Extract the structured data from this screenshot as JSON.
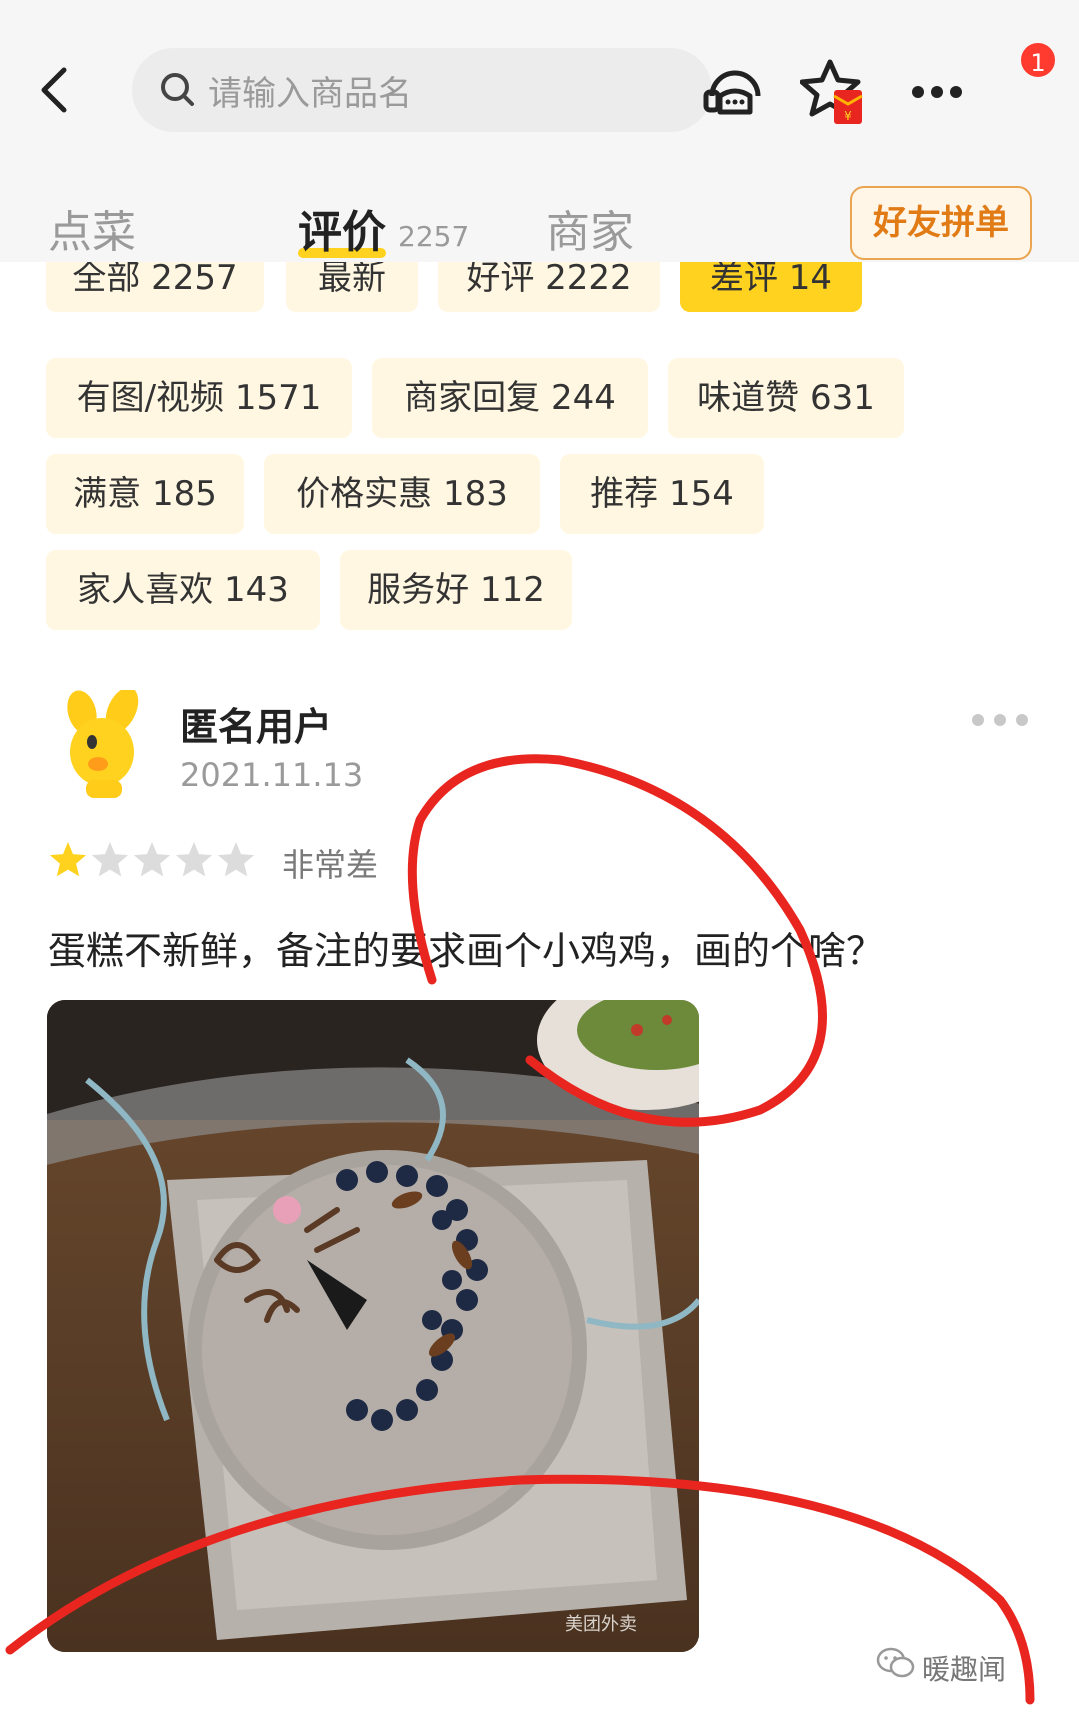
{
  "header": {
    "search_placeholder": "请输入商品名",
    "notification_count": "1"
  },
  "tabs": [
    {
      "label": "点菜"
    },
    {
      "label": "评价",
      "count": "2257"
    },
    {
      "label": "商家"
    }
  ],
  "friend_order_label": "好友拼单",
  "filters": [
    {
      "label": "全部 2257"
    },
    {
      "label": "最新"
    },
    {
      "label": "好评 2222"
    },
    {
      "label": "差评 14",
      "selected": true
    },
    {
      "label": "有图/视频 1571"
    },
    {
      "label": "商家回复 244"
    },
    {
      "label": "味道赞 631"
    },
    {
      "label": "满意 185"
    },
    {
      "label": "价格实惠 183"
    },
    {
      "label": "推荐 154"
    },
    {
      "label": "家人喜欢 143"
    },
    {
      "label": "服务好 112"
    }
  ],
  "review": {
    "user": "匿名用户",
    "date": "2021.11.13",
    "stars": 1,
    "max_stars": 5,
    "rating_text": "非常差",
    "text": "蛋糕不新鲜，备注的要求画个小鸡鸡，画的个啥？",
    "photo_watermark": "美团外卖"
  },
  "watermark": "暖趣闻",
  "colors": {
    "accent_yellow": "#ffd21f",
    "chip_bg": "#fff7e2",
    "friend_btn_text": "#e07b16",
    "annotation_red": "#e8261f"
  }
}
